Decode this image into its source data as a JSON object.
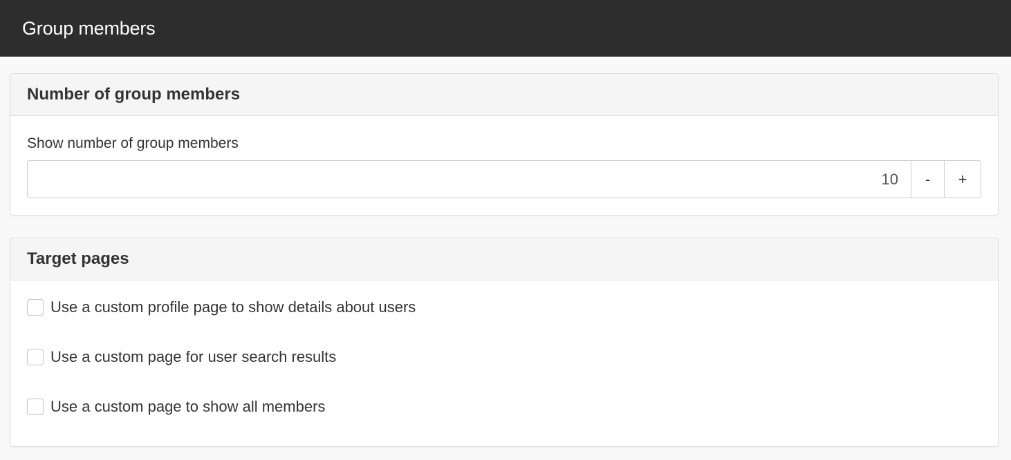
{
  "header": {
    "title": "Group members"
  },
  "members_panel": {
    "title": "Number of group members",
    "field_label": "Show number of group members",
    "value": "10",
    "decrement_label": "-",
    "increment_label": "+"
  },
  "target_panel": {
    "title": "Target pages",
    "options": [
      {
        "label": "Use a custom profile page to show details about users",
        "checked": false
      },
      {
        "label": "Use a custom page for user search results",
        "checked": false
      },
      {
        "label": "Use a custom page to show all members",
        "checked": false
      }
    ]
  }
}
